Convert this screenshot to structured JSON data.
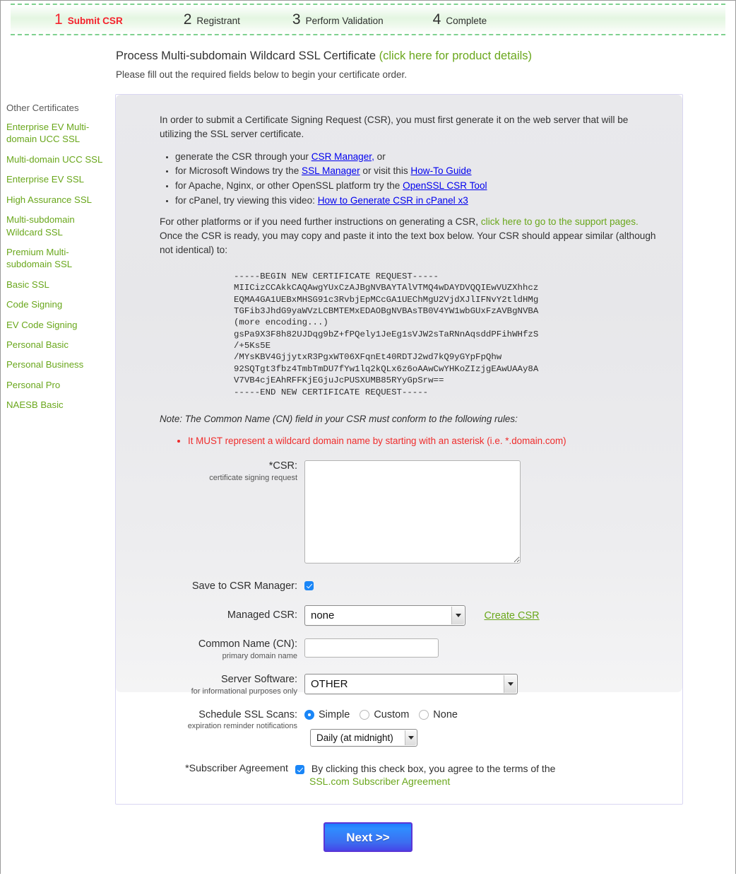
{
  "steps": [
    {
      "num": "1",
      "label": "Submit CSR",
      "active": true
    },
    {
      "num": "2",
      "label": "Registrant",
      "active": false
    },
    {
      "num": "3",
      "label": "Perform Validation",
      "active": false
    },
    {
      "num": "4",
      "label": "Complete",
      "active": false
    }
  ],
  "header": {
    "title": "Process Multi-subdomain Wildcard SSL Certificate",
    "title_link": "(click here for product details)",
    "subtitle": "Please fill out the required fields below to begin your certificate order."
  },
  "sidebar": {
    "heading": "Other Certificates",
    "items": [
      "Enterprise EV Multi-domain UCC SSL",
      "Multi-domain UCC SSL",
      "Enterprise EV SSL",
      "High Assurance SSL",
      "Multi-subdomain Wildcard SSL",
      "Premium Multi-subdomain SSL",
      "Basic SSL",
      "Code Signing",
      "EV Code Signing",
      "Personal Basic",
      "Personal Business",
      "Personal Pro",
      "NAESB Basic"
    ]
  },
  "instructions": {
    "intro": "In order to submit a Certificate Signing Request (CSR), you must first generate it on the web server that will be utilizing the SSL server certificate.",
    "bullets": [
      {
        "pre": "generate the CSR through your ",
        "link": "CSR Manager,",
        "post": " or"
      },
      {
        "pre": "for Microsoft Windows try the ",
        "link": "SSL Manager",
        "mid": " or visit this ",
        "link2": "How-To Guide",
        "post": ""
      },
      {
        "pre": "for Apache, Nginx, or other OpenSSL platform try the ",
        "link": "OpenSSL CSR Tool",
        "post": ""
      },
      {
        "pre": "for cPanel, try viewing this video: ",
        "link": "How to Generate CSR in cPanel x3",
        "post": ""
      }
    ],
    "para2_a": "For other platforms or if you need further instructions on generating a CSR, ",
    "para2_link": "click here to go to the support pages.",
    "para2_b": " Once the CSR is ready, you may copy and paste it into the text box below. Your CSR should appear similar (although not identical) to:",
    "csr_sample": "-----BEGIN NEW CERTIFICATE REQUEST-----\nMIICizCCAkkCAQAwgYUxCzAJBgNVBAYTAlVTMQ4wDAYDVQQIEwVUZXhhcz\nEQMA4GA1UEBxMHSG91c3RvbjEpMCcGA1UEChMgU2VjdXJlIFNvY2tldHMg\nTGFib3JhdG9yaWVzLCBMTEMxEDAOBgNVBAsTB0V4YW1wbGUxFzAVBgNVBA\n(more encoding...)\ngsPa9X3F8h82UJDqg9bZ+fPQely1JeEg1sVJW2sTaRNnAqsddPFihWHfzS\n/+5Ks5E\n/MYsKBV4GjjytxR3PgxWT06XFqnEt40RDTJ2wd7kQ9yGYpFpQhw\n92SQTgt3fbz4TmbTmDU7fYw1lq2kQLx6z6oAAwCwYHKoZIzjgEAwUAAy8A\nV7VB4cjEAhRFFKjEGjuJcPUSXUMB85RYyGpSrw==\n-----END NEW CERTIFICATE REQUEST-----",
    "note": "Note: The Common Name (CN) field in your CSR must conform to the following rules:",
    "red_rule": "It MUST represent a wildcard domain name by starting with an asterisk (i.e. *.domain.com)"
  },
  "form": {
    "csr": {
      "label": "*CSR:",
      "sublabel": "certificate signing request",
      "value": ""
    },
    "save_csr_manager": {
      "label": "Save to CSR Manager:",
      "checked": true
    },
    "managed_csr": {
      "label": "Managed CSR:",
      "value": "none",
      "link": "Create CSR"
    },
    "common_name": {
      "label": "Common Name (CN):",
      "sublabel": "primary domain name",
      "value": "",
      "placeholder": ""
    },
    "server_software": {
      "label": "Server Software:",
      "sublabel": "for informational purposes only",
      "value": "OTHER"
    },
    "schedule_scans": {
      "label": "Schedule SSL Scans:",
      "sublabel": "expiration reminder notifications",
      "options": [
        "Simple",
        "Custom",
        "None"
      ],
      "selected": "Simple",
      "frequency": "Daily (at midnight)"
    },
    "subscriber_agreement": {
      "label": "*Subscriber Agreement",
      "checked": true,
      "text": "By clicking this check box, you agree to the terms of the",
      "link": "SSL.com Subscriber Agreement"
    }
  },
  "footer": {
    "next_label": "Next >>"
  },
  "colors": {
    "accent_green": "#6aa71c",
    "alert_red": "#ef2b2b",
    "button_blue": "#2f8dff",
    "checkbox_blue": "#1a86f7"
  }
}
